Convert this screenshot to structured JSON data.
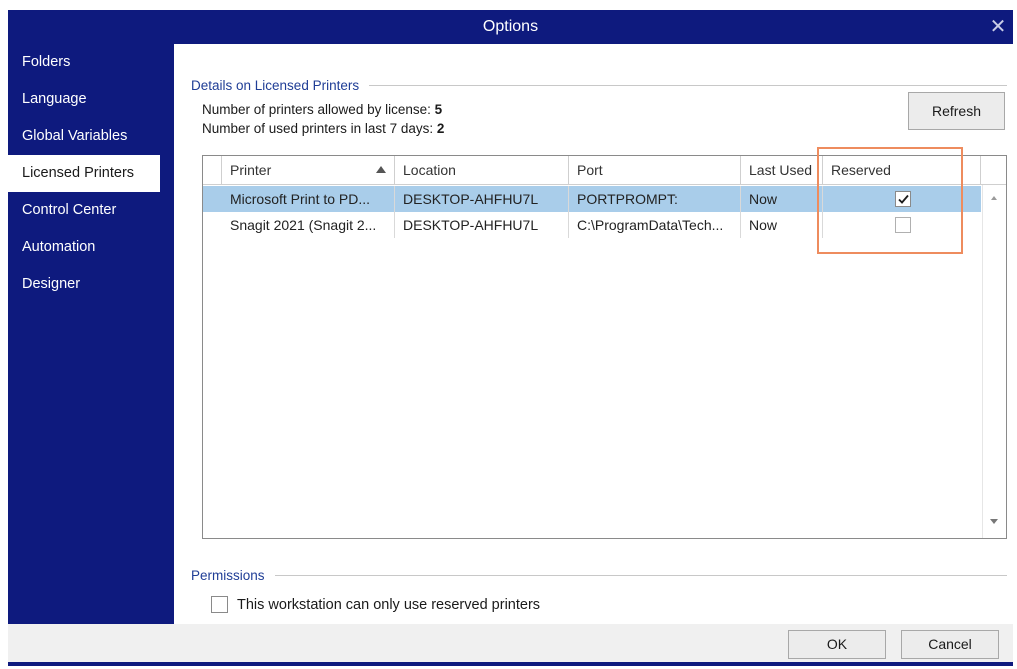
{
  "window": {
    "title": "Options",
    "close_glyph": "✕"
  },
  "sidebar": {
    "items": [
      {
        "label": "Folders",
        "active": false
      },
      {
        "label": "Language",
        "active": false
      },
      {
        "label": "Global Variables",
        "active": false
      },
      {
        "label": "Licensed Printers",
        "active": true
      },
      {
        "label": "Control Center",
        "active": false
      },
      {
        "label": "Automation",
        "active": false
      },
      {
        "label": "Designer",
        "active": false
      }
    ]
  },
  "details": {
    "header": "Details on Licensed Printers",
    "allowed_label": "Number of printers allowed by license:",
    "allowed_value": "5",
    "used_label": "Number of used printers in last 7 days:",
    "used_value": "2",
    "refresh_label": "Refresh"
  },
  "table": {
    "columns": [
      "Printer",
      "Location",
      "Port",
      "Last Used",
      "Reserved"
    ],
    "sort_column": "Printer",
    "sort_direction": "ascending",
    "rows": [
      {
        "printer": "Microsoft Print to PD...",
        "location": "DESKTOP-AHFHU7L",
        "port": "PORTPROMPT:",
        "last_used": "Now",
        "reserved": true,
        "selected": true
      },
      {
        "printer": "Snagit 2021 (Snagit 2...",
        "location": "DESKTOP-AHFHU7L",
        "port": "C:\\ProgramData\\Tech...",
        "last_used": "Now",
        "reserved": false,
        "selected": false
      }
    ]
  },
  "permissions": {
    "header": "Permissions",
    "checkbox_label": "This workstation can only use reserved printers",
    "checked": false
  },
  "footer": {
    "ok_label": "OK",
    "cancel_label": "Cancel"
  },
  "colors": {
    "sidebar_bg": "#0e1a7e",
    "selected_row": "#a9cdea",
    "highlight_border": "#ee8c5e",
    "group_header": "#1f3d96"
  }
}
